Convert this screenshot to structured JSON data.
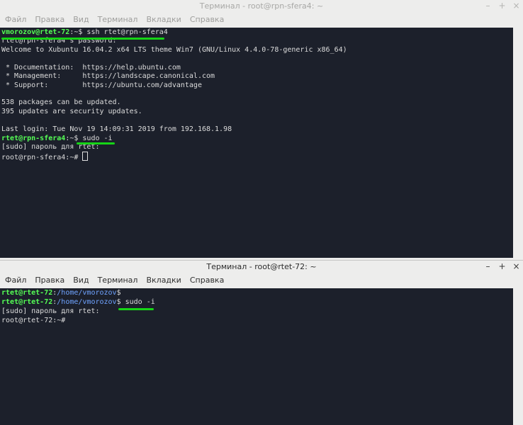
{
  "top_window": {
    "title": "Терминал - root@rpn-sfera4: ~",
    "controls": {
      "minimize": "–",
      "maximize": "+",
      "close": "×"
    },
    "menu": [
      "Файл",
      "Правка",
      "Вид",
      "Терминал",
      "Вкладки",
      "Справка"
    ],
    "lines": [
      "rtet@rpn-sfera4's password:",
      "Welcome to Xubuntu 16.04.2 x64 LTS theme Win7 (GNU/Linux 4.4.0-78-generic x86_64)",
      "",
      " * Documentation:  https://help.ubuntu.com",
      " * Management:     https://landscape.canonical.com",
      " * Support:        https://ubuntu.com/advantage",
      "",
      "538 packages can be updated.",
      "395 updates are security updates.",
      "",
      "Last login: Tue Nov 19 14:09:31 2019 from 192.168.1.98"
    ],
    "prompt1_user": "vmorozov@rtet-72",
    "prompt1_rest": ":~$ ",
    "prompt1_cmd": "ssh rtet@rpn-sfera4",
    "prompt2_user": "rtet@rpn-sfera4",
    "prompt2_rest": ":~$ ",
    "prompt2_cmd": "sudo -i",
    "sudo_line": "[sudo] пароль для rtet:",
    "root_prompt": "root@rpn-sfera4:~# "
  },
  "bottom_window": {
    "title": "Терминал - root@rtet-72: ~",
    "controls": {
      "minimize": "–",
      "maximize": "+",
      "close": "×"
    },
    "menu": [
      "Файл",
      "Правка",
      "Вид",
      "Терминал",
      "Вкладки",
      "Справка"
    ],
    "prompt_user": "rtet@rtet-72",
    "prompt_colon": ":",
    "prompt_path": "/home/vmorozov",
    "prompt_dollar": "$",
    "prompt2_dollar": "$ ",
    "prompt2_cmd": "sudo -i",
    "sudo_line": "[sudo] пароль для rtet:",
    "root_prompt": "root@rtet-72:~#"
  },
  "colors": {
    "terminal_bg": "#1c202b",
    "prompt_user": "#55ff55",
    "prompt_path": "#6fa3ff",
    "highlight_mark": "#16d416"
  }
}
